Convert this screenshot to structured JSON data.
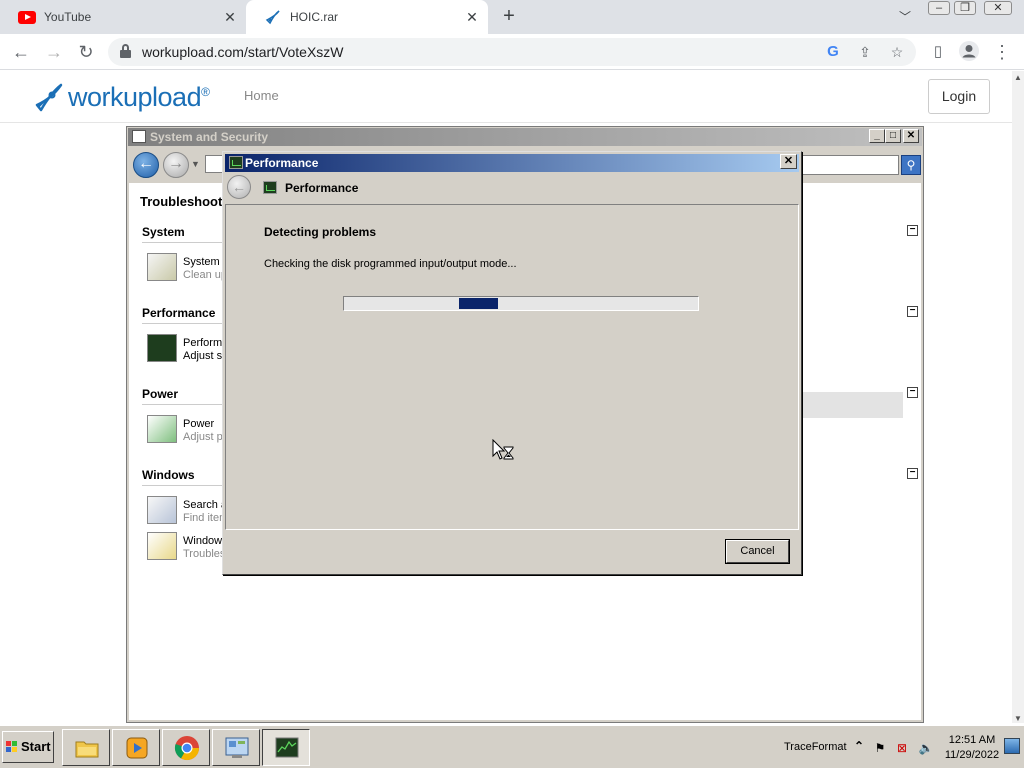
{
  "browser": {
    "tabs": [
      {
        "title": "YouTube",
        "icon": "youtube-icon"
      },
      {
        "title": "HOIC.rar",
        "icon": "rocket-icon",
        "active": true
      }
    ],
    "new_tab": "+",
    "url": "workupload.com/start/VoteXszW"
  },
  "site": {
    "logo_text": "workupload",
    "logo_reg": "®",
    "nav_home": "Home",
    "login": "Login"
  },
  "control_panel": {
    "title": "System and Security",
    "heading": "Troubleshoot p",
    "sections": [
      {
        "label": "System",
        "items": [
          {
            "title": "System l",
            "sub": "Clean up"
          }
        ]
      },
      {
        "label": "Performance",
        "items": [
          {
            "title": "Performa",
            "sub": "Adjust s"
          }
        ]
      },
      {
        "label": "Power",
        "items": [
          {
            "title": "Power",
            "sub": "Adjust p"
          }
        ]
      },
      {
        "label": "Windows",
        "items": [
          {
            "title": "Search a",
            "sub": "Find item"
          },
          {
            "title": "Windows",
            "sub": "Troubles"
          }
        ]
      }
    ],
    "collapse_glyph": "−"
  },
  "dialog": {
    "title": "Performance",
    "header_title": "Performance",
    "heading": "Detecting problems",
    "status": "Checking the disk programmed input/output mode...",
    "progress": {
      "segment_start": 0.325,
      "segment_end": 0.435
    },
    "cancel": "Cancel",
    "close": "✕"
  },
  "taskbar": {
    "start": "Start",
    "tray_label": "TraceFormat",
    "time": "12:51 AM",
    "date": "11/29/2022"
  },
  "colors": {
    "dialog_title_start": "#0a246a",
    "dialog_title_end": "#a6caf0",
    "progress_fill": "#0a246a",
    "workupload_blue": "#1b6fb6",
    "classic_face": "#d4d0c8"
  }
}
